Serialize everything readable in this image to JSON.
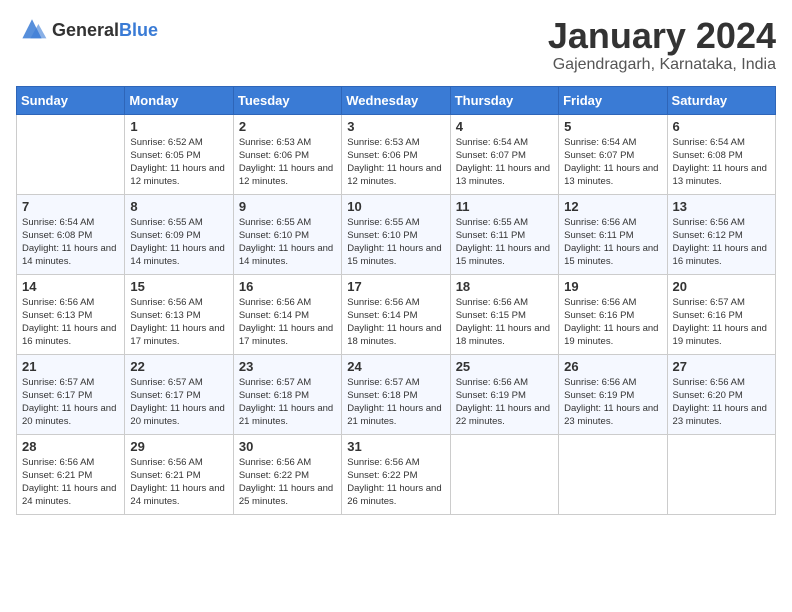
{
  "header": {
    "logo_general": "General",
    "logo_blue": "Blue",
    "title": "January 2024",
    "subtitle": "Gajendragarh, Karnataka, India"
  },
  "days_of_week": [
    "Sunday",
    "Monday",
    "Tuesday",
    "Wednesday",
    "Thursday",
    "Friday",
    "Saturday"
  ],
  "weeks": [
    [
      {
        "day": "",
        "sunrise": "",
        "sunset": "",
        "daylight": ""
      },
      {
        "day": "1",
        "sunrise": "Sunrise: 6:52 AM",
        "sunset": "Sunset: 6:05 PM",
        "daylight": "Daylight: 11 hours and 12 minutes."
      },
      {
        "day": "2",
        "sunrise": "Sunrise: 6:53 AM",
        "sunset": "Sunset: 6:06 PM",
        "daylight": "Daylight: 11 hours and 12 minutes."
      },
      {
        "day": "3",
        "sunrise": "Sunrise: 6:53 AM",
        "sunset": "Sunset: 6:06 PM",
        "daylight": "Daylight: 11 hours and 12 minutes."
      },
      {
        "day": "4",
        "sunrise": "Sunrise: 6:54 AM",
        "sunset": "Sunset: 6:07 PM",
        "daylight": "Daylight: 11 hours and 13 minutes."
      },
      {
        "day": "5",
        "sunrise": "Sunrise: 6:54 AM",
        "sunset": "Sunset: 6:07 PM",
        "daylight": "Daylight: 11 hours and 13 minutes."
      },
      {
        "day": "6",
        "sunrise": "Sunrise: 6:54 AM",
        "sunset": "Sunset: 6:08 PM",
        "daylight": "Daylight: 11 hours and 13 minutes."
      }
    ],
    [
      {
        "day": "7",
        "sunrise": "Sunrise: 6:54 AM",
        "sunset": "Sunset: 6:08 PM",
        "daylight": "Daylight: 11 hours and 14 minutes."
      },
      {
        "day": "8",
        "sunrise": "Sunrise: 6:55 AM",
        "sunset": "Sunset: 6:09 PM",
        "daylight": "Daylight: 11 hours and 14 minutes."
      },
      {
        "day": "9",
        "sunrise": "Sunrise: 6:55 AM",
        "sunset": "Sunset: 6:10 PM",
        "daylight": "Daylight: 11 hours and 14 minutes."
      },
      {
        "day": "10",
        "sunrise": "Sunrise: 6:55 AM",
        "sunset": "Sunset: 6:10 PM",
        "daylight": "Daylight: 11 hours and 15 minutes."
      },
      {
        "day": "11",
        "sunrise": "Sunrise: 6:55 AM",
        "sunset": "Sunset: 6:11 PM",
        "daylight": "Daylight: 11 hours and 15 minutes."
      },
      {
        "day": "12",
        "sunrise": "Sunrise: 6:56 AM",
        "sunset": "Sunset: 6:11 PM",
        "daylight": "Daylight: 11 hours and 15 minutes."
      },
      {
        "day": "13",
        "sunrise": "Sunrise: 6:56 AM",
        "sunset": "Sunset: 6:12 PM",
        "daylight": "Daylight: 11 hours and 16 minutes."
      }
    ],
    [
      {
        "day": "14",
        "sunrise": "Sunrise: 6:56 AM",
        "sunset": "Sunset: 6:13 PM",
        "daylight": "Daylight: 11 hours and 16 minutes."
      },
      {
        "day": "15",
        "sunrise": "Sunrise: 6:56 AM",
        "sunset": "Sunset: 6:13 PM",
        "daylight": "Daylight: 11 hours and 17 minutes."
      },
      {
        "day": "16",
        "sunrise": "Sunrise: 6:56 AM",
        "sunset": "Sunset: 6:14 PM",
        "daylight": "Daylight: 11 hours and 17 minutes."
      },
      {
        "day": "17",
        "sunrise": "Sunrise: 6:56 AM",
        "sunset": "Sunset: 6:14 PM",
        "daylight": "Daylight: 11 hours and 18 minutes."
      },
      {
        "day": "18",
        "sunrise": "Sunrise: 6:56 AM",
        "sunset": "Sunset: 6:15 PM",
        "daylight": "Daylight: 11 hours and 18 minutes."
      },
      {
        "day": "19",
        "sunrise": "Sunrise: 6:56 AM",
        "sunset": "Sunset: 6:16 PM",
        "daylight": "Daylight: 11 hours and 19 minutes."
      },
      {
        "day": "20",
        "sunrise": "Sunrise: 6:57 AM",
        "sunset": "Sunset: 6:16 PM",
        "daylight": "Daylight: 11 hours and 19 minutes."
      }
    ],
    [
      {
        "day": "21",
        "sunrise": "Sunrise: 6:57 AM",
        "sunset": "Sunset: 6:17 PM",
        "daylight": "Daylight: 11 hours and 20 minutes."
      },
      {
        "day": "22",
        "sunrise": "Sunrise: 6:57 AM",
        "sunset": "Sunset: 6:17 PM",
        "daylight": "Daylight: 11 hours and 20 minutes."
      },
      {
        "day": "23",
        "sunrise": "Sunrise: 6:57 AM",
        "sunset": "Sunset: 6:18 PM",
        "daylight": "Daylight: 11 hours and 21 minutes."
      },
      {
        "day": "24",
        "sunrise": "Sunrise: 6:57 AM",
        "sunset": "Sunset: 6:18 PM",
        "daylight": "Daylight: 11 hours and 21 minutes."
      },
      {
        "day": "25",
        "sunrise": "Sunrise: 6:56 AM",
        "sunset": "Sunset: 6:19 PM",
        "daylight": "Daylight: 11 hours and 22 minutes."
      },
      {
        "day": "26",
        "sunrise": "Sunrise: 6:56 AM",
        "sunset": "Sunset: 6:19 PM",
        "daylight": "Daylight: 11 hours and 23 minutes."
      },
      {
        "day": "27",
        "sunrise": "Sunrise: 6:56 AM",
        "sunset": "Sunset: 6:20 PM",
        "daylight": "Daylight: 11 hours and 23 minutes."
      }
    ],
    [
      {
        "day": "28",
        "sunrise": "Sunrise: 6:56 AM",
        "sunset": "Sunset: 6:21 PM",
        "daylight": "Daylight: 11 hours and 24 minutes."
      },
      {
        "day": "29",
        "sunrise": "Sunrise: 6:56 AM",
        "sunset": "Sunset: 6:21 PM",
        "daylight": "Daylight: 11 hours and 24 minutes."
      },
      {
        "day": "30",
        "sunrise": "Sunrise: 6:56 AM",
        "sunset": "Sunset: 6:22 PM",
        "daylight": "Daylight: 11 hours and 25 minutes."
      },
      {
        "day": "31",
        "sunrise": "Sunrise: 6:56 AM",
        "sunset": "Sunset: 6:22 PM",
        "daylight": "Daylight: 11 hours and 26 minutes."
      },
      {
        "day": "",
        "sunrise": "",
        "sunset": "",
        "daylight": ""
      },
      {
        "day": "",
        "sunrise": "",
        "sunset": "",
        "daylight": ""
      },
      {
        "day": "",
        "sunrise": "",
        "sunset": "",
        "daylight": ""
      }
    ]
  ]
}
